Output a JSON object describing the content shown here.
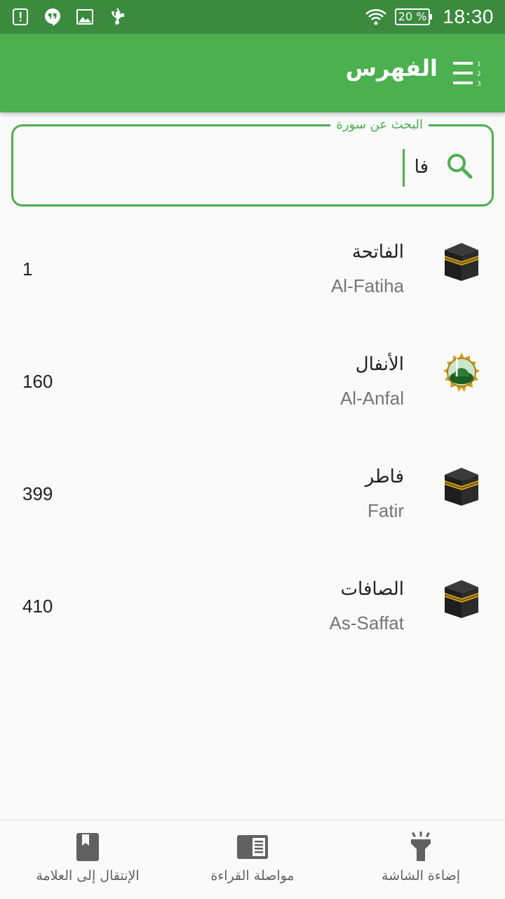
{
  "status_bar": {
    "time": "18:30",
    "battery": "20 %",
    "icons": [
      "alert-icon",
      "hangouts-icon",
      "image-icon",
      "usb-icon",
      "wifi-icon",
      "battery-icon"
    ]
  },
  "app_bar": {
    "title": "الفهرس",
    "menu_icon": "numbered-list-icon",
    "color": "#4caf50"
  },
  "search": {
    "label": "البحث عن سورة",
    "value": "فا",
    "icon": "search-icon"
  },
  "surahs": [
    {
      "name_ar": "الفاتحة",
      "name_en": "Al-Fatiha",
      "page": "1",
      "icon": "kaaba-icon"
    },
    {
      "name_ar": "الأنفال",
      "name_en": "Al-Anfal",
      "page": "160",
      "icon": "medina-mosque-icon"
    },
    {
      "name_ar": "فاطر",
      "name_en": "Fatir",
      "page": "399",
      "icon": "kaaba-icon"
    },
    {
      "name_ar": "الصافات",
      "name_en": "As-Saffat",
      "page": "410",
      "icon": "kaaba-icon"
    }
  ],
  "bottom_nav": {
    "go_to_bookmark": {
      "label": "الإنتقال إلى العلامة",
      "icon": "bookmark-icon"
    },
    "continue_reading": {
      "label": "مواصلة القراءة",
      "icon": "book-open-icon"
    },
    "screen_light": {
      "label": "إضاءة الشاشة",
      "icon": "flashlight-icon"
    }
  },
  "colors": {
    "status_bar": "#3b8a3e",
    "accent": "#4caf50",
    "text_primary": "#212121",
    "text_secondary": "#757575"
  }
}
